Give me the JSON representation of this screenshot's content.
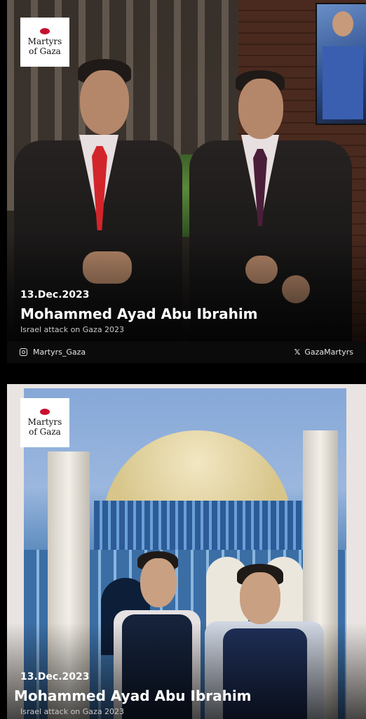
{
  "brand": {
    "logo_line1": "Martyrs",
    "logo_line2": "of Gaza"
  },
  "cards": [
    {
      "date": "13.Dec.2023",
      "name": "Mohammed Ayad Abu Ibrahim",
      "subtitle": "Israel attack on Gaza 2023",
      "instagram_handle": "Martyrs_Gaza",
      "x_handle": "GazaMartyrs"
    },
    {
      "date": "13.Dec.2023",
      "name": "Mohammed Ayad Abu Ibrahim",
      "subtitle": "Israel attack on Gaza 2023"
    }
  ],
  "icons": {
    "instagram": "instagram-icon",
    "x": "x-logo-icon",
    "logo_mark": "red-drop-icon"
  },
  "colors": {
    "background": "#000000",
    "footer": "#0b0b0b",
    "logo_mark": "#c8102e",
    "text": "#ffffff"
  }
}
